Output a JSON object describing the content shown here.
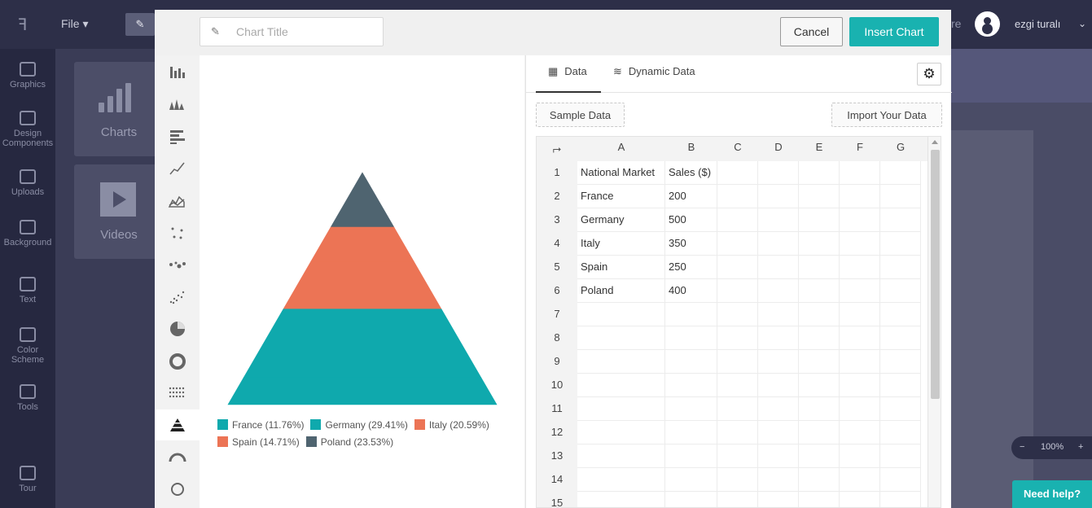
{
  "app": {
    "file_menu": "File",
    "share_label": "re",
    "username": "ezgi turalı",
    "zoom": "100%",
    "help": "Need help?"
  },
  "nav": {
    "items": [
      {
        "label": "Graphics",
        "icon": "image-icon"
      },
      {
        "label": "Design Components",
        "icon": "components-icon"
      },
      {
        "label": "Uploads",
        "icon": "cloud-upload-icon"
      },
      {
        "label": "Background",
        "icon": "hatch-icon"
      },
      {
        "label": "Text",
        "icon": "text-icon"
      },
      {
        "label": "Color Scheme",
        "icon": "palette-icon"
      },
      {
        "label": "Tools",
        "icon": "toolbox-icon"
      },
      {
        "label": "Tour",
        "icon": "signpost-icon"
      }
    ]
  },
  "panel": {
    "tiles": [
      {
        "label": "Charts"
      },
      {
        "label": "Videos"
      }
    ]
  },
  "modal": {
    "title_placeholder": "Chart Title",
    "cancel": "Cancel",
    "insert": "Insert Chart"
  },
  "chart_types": [
    "bar-chart-icon",
    "stacked-peaks-icon",
    "horizontal-bar-icon",
    "line-chart-icon",
    "area-chart-icon",
    "scatter-icon",
    "bubble-icon",
    "scatter-dense-icon",
    "pie-chart-icon",
    "donut-chart-icon",
    "dot-matrix-icon",
    "pyramid-chart-icon",
    "gauge-icon",
    "ring-icon"
  ],
  "active_chart_type": 11,
  "chart_data": {
    "type": "pyramid",
    "categories": [
      "National Market",
      "France",
      "Germany",
      "Italy",
      "Spain",
      "Poland"
    ],
    "series": [
      {
        "name": "Sales ($)",
        "values": [
          200,
          500,
          350,
          250,
          400
        ]
      }
    ],
    "slices": [
      {
        "label": "France",
        "value": 200,
        "percent": "11.76%",
        "color": "#0fa9ad"
      },
      {
        "label": "Germany",
        "value": 500,
        "percent": "29.41%",
        "color": "#0fa9ad"
      },
      {
        "label": "Italy",
        "value": 350,
        "percent": "20.59%",
        "color": "#ec7455"
      },
      {
        "label": "Spain",
        "value": 250,
        "percent": "14.71%",
        "color": "#ec7455"
      },
      {
        "label": "Poland",
        "value": 400,
        "percent": "23.53%",
        "color": "#4f6470"
      }
    ],
    "legend": [
      {
        "text": "France (11.76%)",
        "color": "#0fa9ad"
      },
      {
        "text": "Germany (29.41%)",
        "color": "#0fa9ad"
      },
      {
        "text": "Italy (20.59%)",
        "color": "#ec7455"
      },
      {
        "text": "Spain (14.71%)",
        "color": "#ec7455"
      },
      {
        "text": "Poland (23.53%)",
        "color": "#4f6470"
      }
    ]
  },
  "data_panel": {
    "tabs": [
      "Data",
      "Dynamic Data"
    ],
    "sample_btn": "Sample Data",
    "import_btn": "Import Your Data",
    "columns": [
      "A",
      "B",
      "C",
      "D",
      "E",
      "F",
      "G"
    ],
    "row_numbers": [
      "1",
      "2",
      "3",
      "4",
      "5",
      "6",
      "7",
      "8",
      "9",
      "10",
      "11",
      "12",
      "13",
      "14",
      "15"
    ],
    "rows": [
      [
        "National Market",
        "Sales ($)"
      ],
      [
        "France",
        "200"
      ],
      [
        "Germany",
        "500"
      ],
      [
        "Italy",
        "350"
      ],
      [
        "Spain",
        "250"
      ],
      [
        "Poland",
        "400"
      ]
    ]
  },
  "colors": {
    "accent": "#19b2b0",
    "teal": "#0fa9ad",
    "coral": "#ec7455",
    "slate": "#4f6470"
  }
}
